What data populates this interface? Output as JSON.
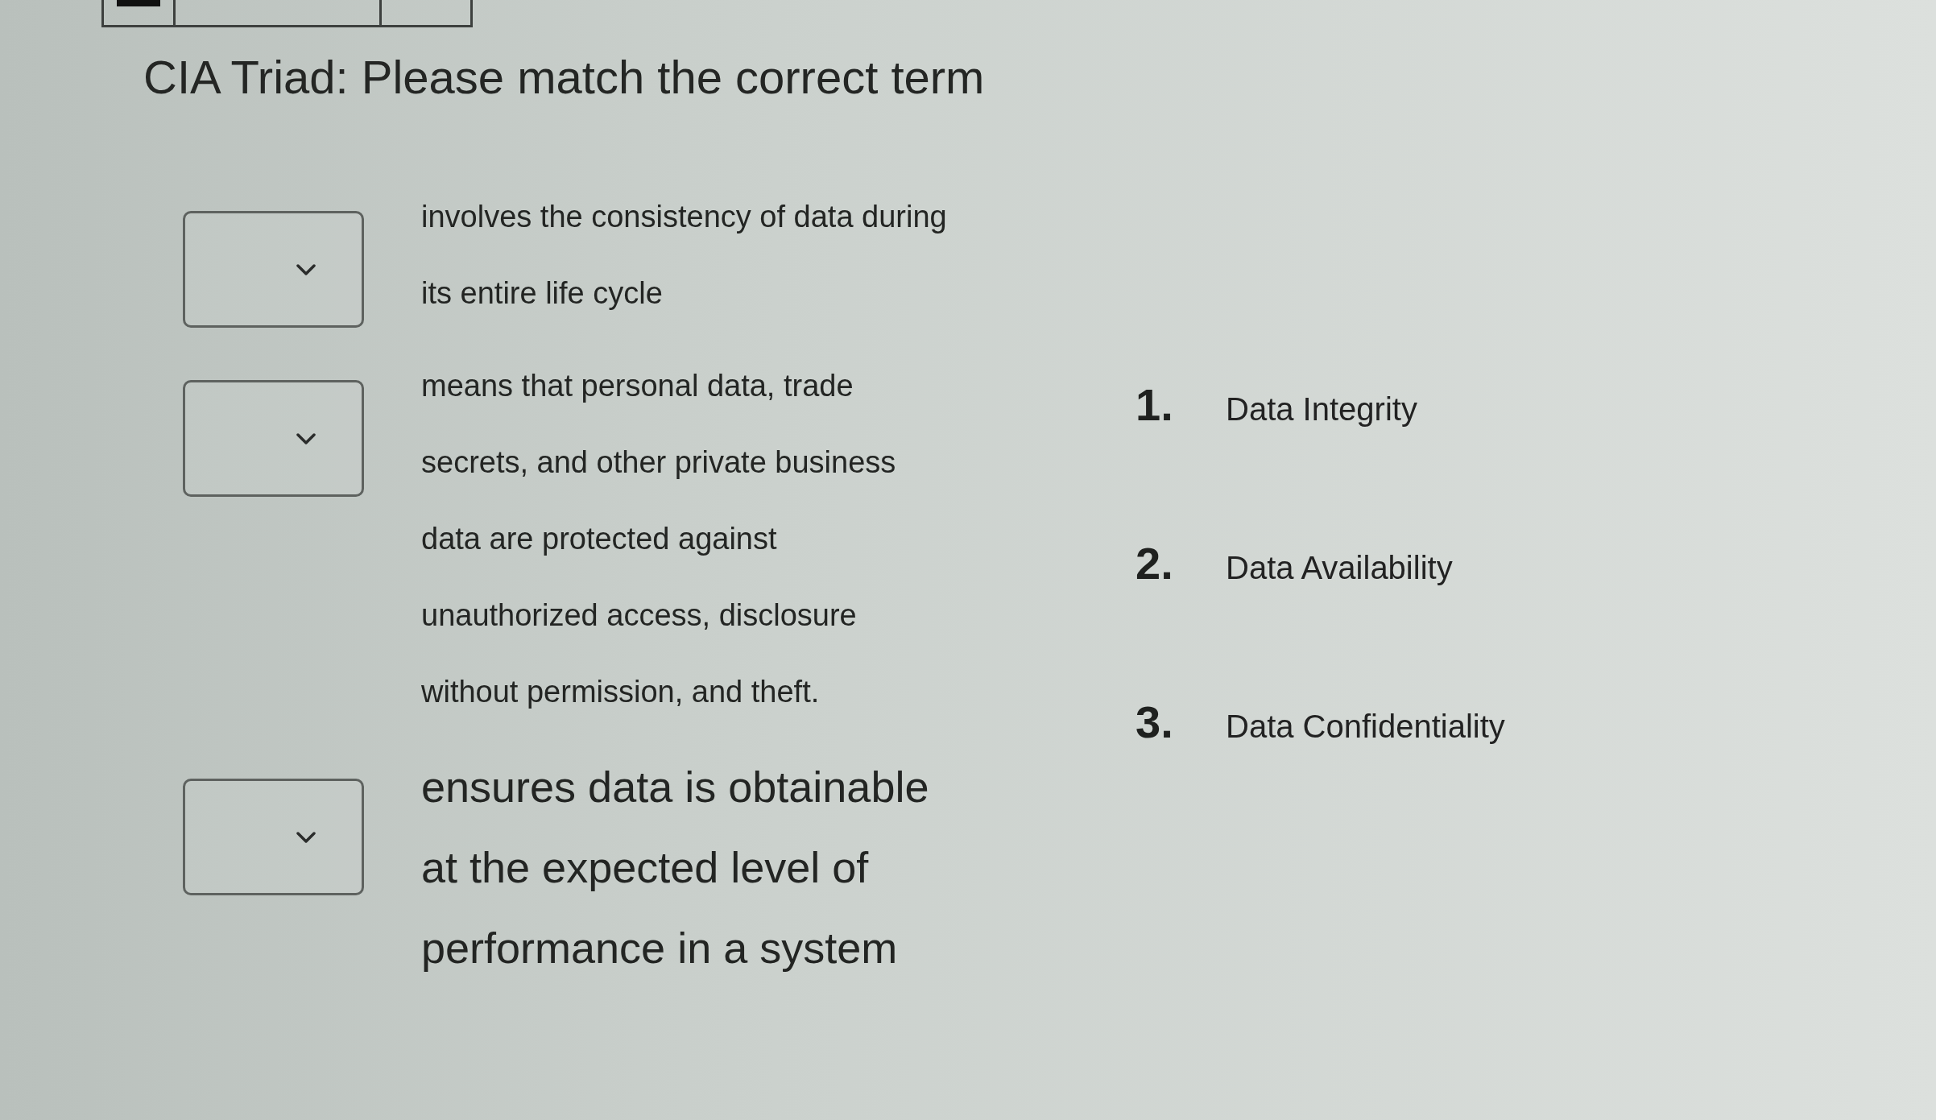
{
  "question": {
    "title": "CIA Triad: Please match the correct term"
  },
  "matches": [
    {
      "kind": "normal",
      "statement": "involves the consistency of data during\nits entire life cycle"
    },
    {
      "kind": "normal",
      "statement": "means that personal data, trade\nsecrets, and other private business\ndata are protected against\nunauthorized access, disclosure\nwithout permission, and theft."
    },
    {
      "kind": "large",
      "statement": "ensures data is obtainable\nat the expected level of\nperformance in a system"
    }
  ],
  "options": [
    {
      "number": "1.",
      "label": "Data Integrity"
    },
    {
      "number": "2.",
      "label": "Data Availability"
    },
    {
      "number": "3.",
      "label": "Data Confidentiality"
    }
  ]
}
